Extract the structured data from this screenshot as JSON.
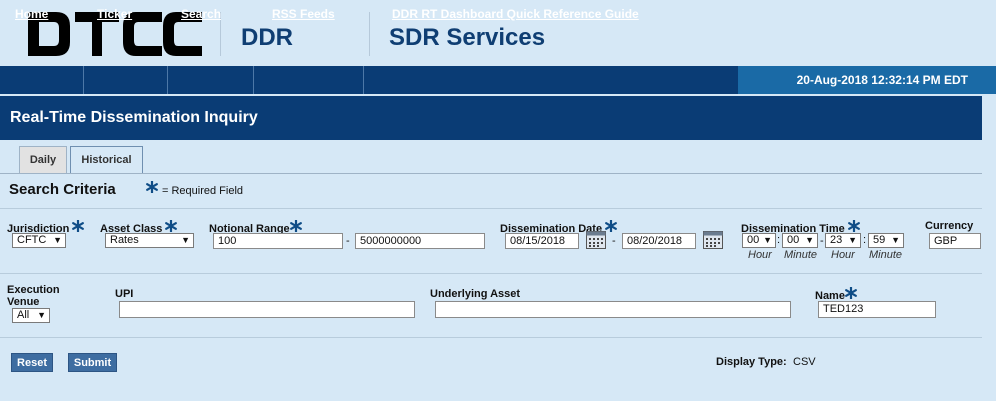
{
  "header": {
    "logo": "DTCC",
    "product": "DDR",
    "service": "SDR Services"
  },
  "nav": {
    "items": [
      "Home",
      "Ticker",
      "Search",
      "RSS Feeds",
      "DDR RT Dashboard Quick Reference Guide"
    ],
    "datetime": "20-Aug-2018 12:32:14 PM EDT"
  },
  "page": {
    "title": "Real-Time Dissemination Inquiry"
  },
  "tabs": [
    "Daily",
    "Historical"
  ],
  "search": {
    "title": "Search Criteria",
    "required_legend": "= Required Field",
    "jurisdiction": {
      "label": "Jurisdiction",
      "value": "CFTC"
    },
    "asset_class": {
      "label": "Asset Class",
      "value": "Rates"
    },
    "notional_range": {
      "label": "Notional Range",
      "from": "100",
      "dash": "-",
      "to": "5000000000"
    },
    "dissemination_date": {
      "label": "Dissemination Date",
      "from": "08/15/2018",
      "dash": "-",
      "to": "08/20/2018"
    },
    "dissemination_time": {
      "label": "Dissemination Time",
      "from_hour": "00",
      "from_minute": "00",
      "to_hour": "23",
      "to_minute": "59",
      "sub_hour": "Hour",
      "sub_minute": "Minute"
    },
    "currency": {
      "label": "Currency",
      "value": "GBP"
    },
    "execution_venue": {
      "label_line1": "Execution",
      "label_line2": "Venue",
      "value": "All"
    },
    "upi": {
      "label": "UPI",
      "value": ""
    },
    "underlying_asset": {
      "label": "Underlying Asset",
      "value": ""
    },
    "name": {
      "label": "Name",
      "value": "TED123"
    }
  },
  "actions": {
    "reset": "Reset",
    "submit": "Submit",
    "display_type_label": "Display Type:",
    "display_type_value": "CSV"
  },
  "colors": {
    "navy": "#0a3c75",
    "accent": "#1a6aa6",
    "background": "#d6e8f6",
    "required_star": "#0f4d87"
  }
}
